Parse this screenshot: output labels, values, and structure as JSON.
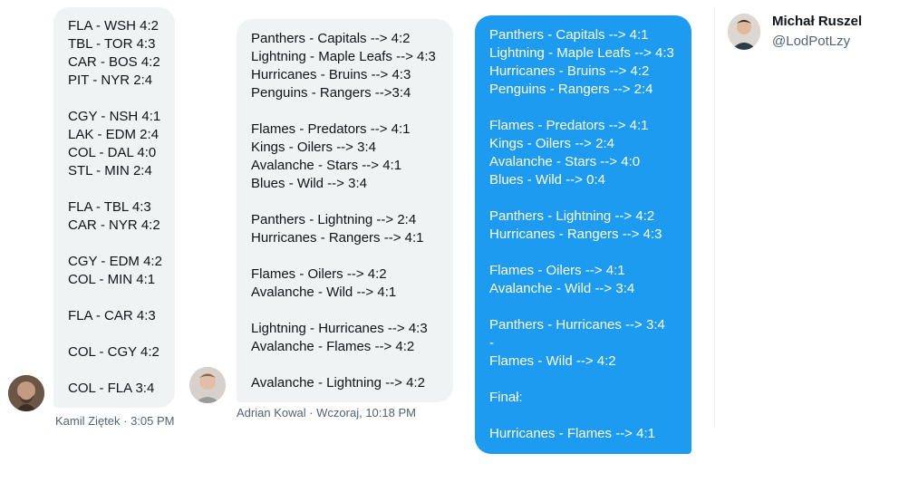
{
  "messages": [
    {
      "sender": "Kamil Ziętek",
      "time": "3:05 PM",
      "meta": "Kamil Ziętek · 3:05 PM",
      "lines": [
        "FLA - WSH 4:2",
        "TBL - TOR 4:3",
        "CAR - BOS 4:2",
        "PIT - NYR 2:4",
        "",
        "CGY - NSH 4:1",
        "LAK - EDM 2:4",
        "COL - DAL 4:0",
        "STL - MIN 2:4",
        "",
        "FLA - TBL 4:3",
        "CAR - NYR 4:2",
        "",
        "CGY - EDM 4:2",
        "COL - MIN 4:1",
        "",
        "FLA - CAR 4:3",
        "",
        "COL - CGY 4:2",
        "",
        "COL - FLA 3:4"
      ]
    },
    {
      "sender": "Adrian Kowal",
      "time": "Wczoraj, 10:18 PM",
      "meta": "Adrian Kowal · Wczoraj, 10:18 PM",
      "lines": [
        "Panthers - Capitals --> 4:2",
        "Lightning - Maple Leafs --> 4:3",
        "Hurricanes - Bruins --> 4:3",
        "Penguins - Rangers -->3:4",
        "",
        "Flames - Predators --> 4:1",
        "Kings - Oilers --> 3:4",
        "Avalanche - Stars --> 4:1",
        "Blues - Wild --> 3:4",
        "",
        "Panthers - Lightning --> 2:4",
        "Hurricanes - Rangers --> 4:1",
        "",
        "Flames - Oilers --> 4:2",
        "Avalanche - Wild --> 4:1",
        "",
        "Lightning - Hurricanes --> 4:3",
        "Avalanche - Flames --> 4:2",
        "",
        "Avalanche - Lightning --> 4:2"
      ]
    },
    {
      "sender": "self",
      "lines": [
        "Panthers - Capitals --> 4:1",
        "Lightning - Maple Leafs --> 4:3",
        "Hurricanes - Bruins --> 4:2",
        "Penguins - Rangers --> 2:4",
        "",
        "Flames - Predators --> 4:1",
        "Kings - Oilers --> 2:4",
        "Avalanche - Stars --> 4:0",
        "Blues - Wild --> 0:4",
        "",
        "Panthers - Lightning --> 4:2",
        "Hurricanes - Rangers --> 4:3",
        "",
        "Flames - Oilers --> 4:1",
        "Avalanche - Wild --> 3:4",
        "",
        "Panthers - Hurricanes --> 3:4",
        "-",
        "Flames - Wild --> 4:2",
        "",
        "Finał:",
        "",
        "Hurricanes - Flames --> 4:1"
      ]
    }
  ],
  "profile": {
    "name": "Michał Ruszel",
    "handle": "@LodPotLzy"
  },
  "colors": {
    "bubble_grey": "#eff3f4",
    "bubble_blue": "#1d9bf0",
    "meta_text": "#536471"
  }
}
